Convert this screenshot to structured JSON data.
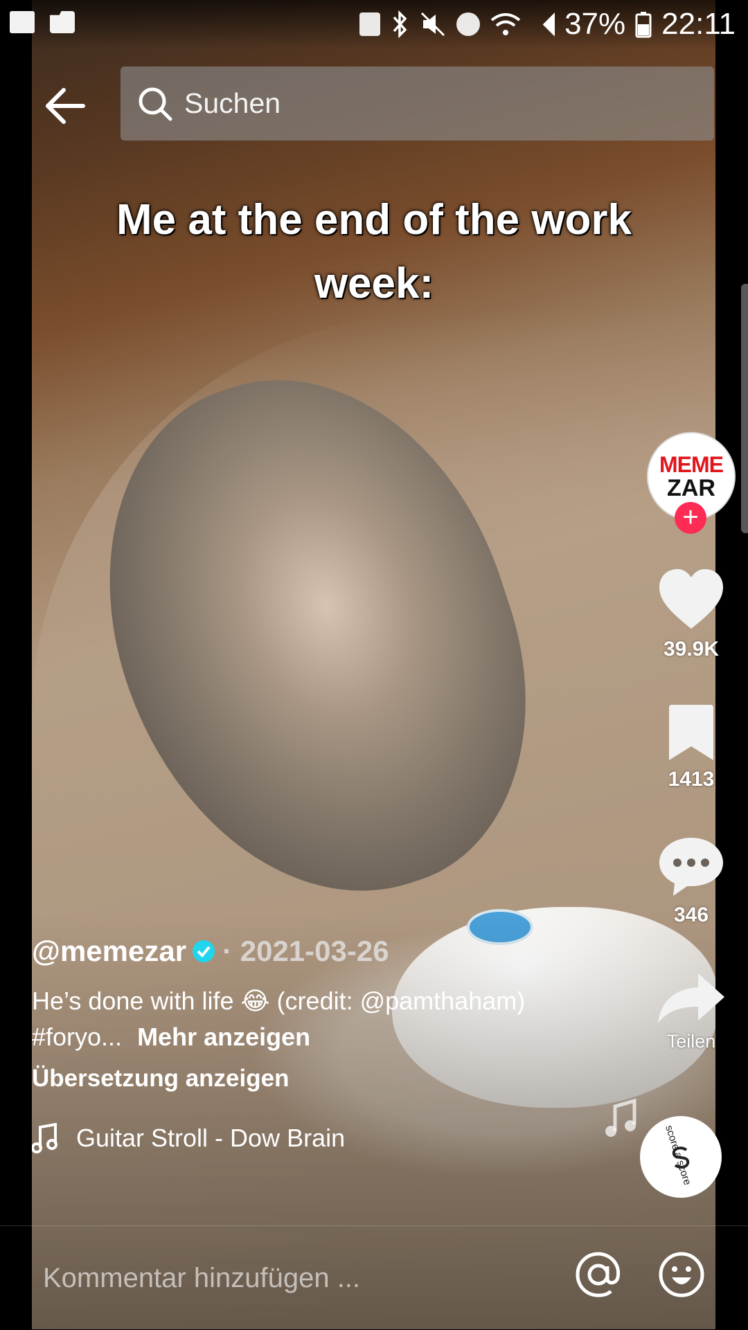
{
  "status_bar": {
    "battery": "37%",
    "time": "22:11",
    "icons": [
      "image-icon",
      "folder-icon",
      "battery-saver-icon",
      "bluetooth-icon",
      "mute-icon",
      "alarm-icon",
      "wifi-icon",
      "signal-icon",
      "battery-icon"
    ]
  },
  "header": {
    "search_placeholder": "Suchen"
  },
  "video": {
    "overlay_caption": "Me at the end of the work week:"
  },
  "rail": {
    "avatar_line1": "MEME",
    "avatar_line2": "ZAR",
    "follow_symbol": "+",
    "likes": "39.9K",
    "saves": "1413",
    "comments": "346",
    "share_label": "Teilen",
    "sound_disc_text": "score a score"
  },
  "post": {
    "author": "@memezar",
    "date": "· 2021-03-26",
    "description": "He’s done with life 😂 (credit: @pamthaham) #foryo...",
    "more_label": "Mehr anzeigen",
    "translate_label": "Übersetzung anzeigen",
    "music": "Guitar Stroll - Dow Brain"
  },
  "comment_bar": {
    "placeholder": "Kommentar hinzufügen ..."
  },
  "colors": {
    "accent": "#fe2c55",
    "verified": "#20d5ec"
  }
}
